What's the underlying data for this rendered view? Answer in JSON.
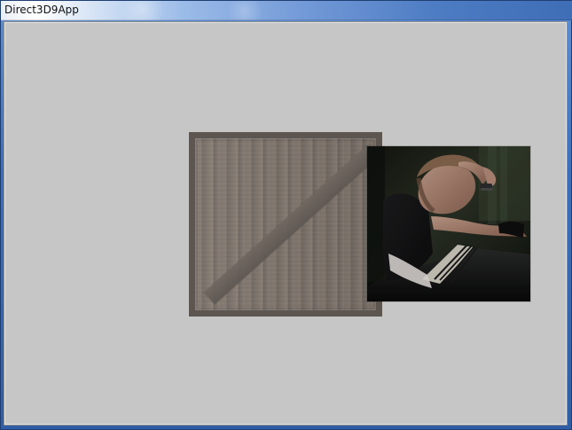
{
  "window": {
    "title": "Direct3D9App"
  },
  "scene": {
    "background": "#c6c6c6",
    "crate_label": "",
    "photo_label": ""
  }
}
